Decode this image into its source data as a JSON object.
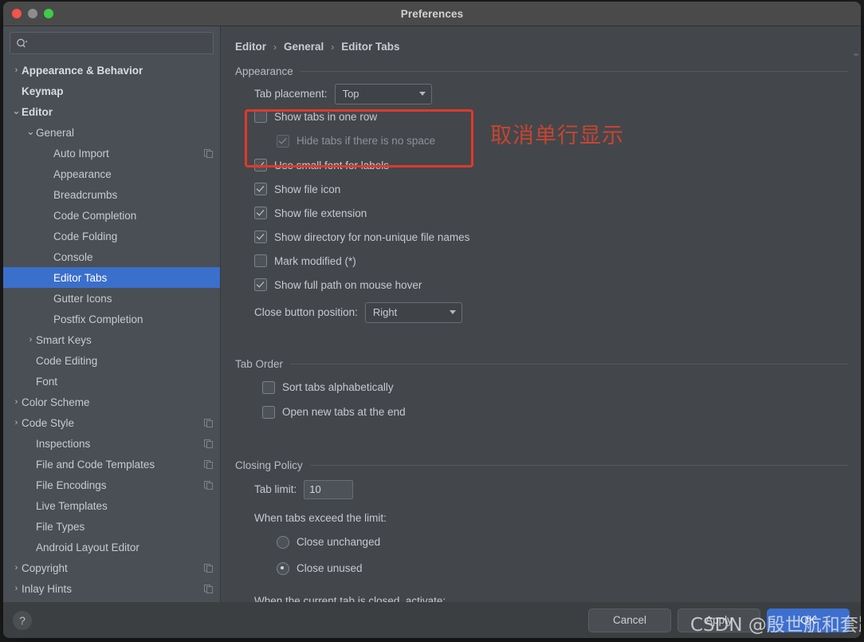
{
  "window": {
    "title": "Preferences",
    "traffic_lights": [
      "close-button",
      "minimize-button",
      "zoom-button"
    ]
  },
  "search": {
    "value": "",
    "placeholder": "",
    "icon": "search-icon"
  },
  "sidebar": {
    "items": [
      {
        "label": "Appearance & Behavior",
        "indent": 0,
        "arrow": "›",
        "bold": true,
        "selected": false,
        "copy": false
      },
      {
        "label": "Keymap",
        "indent": 0,
        "arrow": "",
        "bold": true,
        "selected": false,
        "copy": false
      },
      {
        "label": "Editor",
        "indent": 0,
        "arrow": "⌄",
        "bold": true,
        "selected": false,
        "copy": false
      },
      {
        "label": "General",
        "indent": 1,
        "arrow": "⌄",
        "bold": false,
        "selected": false,
        "copy": false
      },
      {
        "label": "Auto Import",
        "indent": 2,
        "arrow": "",
        "bold": false,
        "selected": false,
        "copy": true
      },
      {
        "label": "Appearance",
        "indent": 2,
        "arrow": "",
        "bold": false,
        "selected": false,
        "copy": false
      },
      {
        "label": "Breadcrumbs",
        "indent": 2,
        "arrow": "",
        "bold": false,
        "selected": false,
        "copy": false
      },
      {
        "label": "Code Completion",
        "indent": 2,
        "arrow": "",
        "bold": false,
        "selected": false,
        "copy": false
      },
      {
        "label": "Code Folding",
        "indent": 2,
        "arrow": "",
        "bold": false,
        "selected": false,
        "copy": false
      },
      {
        "label": "Console",
        "indent": 2,
        "arrow": "",
        "bold": false,
        "selected": false,
        "copy": false
      },
      {
        "label": "Editor Tabs",
        "indent": 2,
        "arrow": "",
        "bold": false,
        "selected": true,
        "copy": false
      },
      {
        "label": "Gutter Icons",
        "indent": 2,
        "arrow": "",
        "bold": false,
        "selected": false,
        "copy": false
      },
      {
        "label": "Postfix Completion",
        "indent": 2,
        "arrow": "",
        "bold": false,
        "selected": false,
        "copy": false
      },
      {
        "label": "Smart Keys",
        "indent": 1,
        "arrow": "›",
        "bold": false,
        "selected": false,
        "copy": false
      },
      {
        "label": "Code Editing",
        "indent": 1,
        "arrow": "",
        "bold": false,
        "selected": false,
        "copy": false
      },
      {
        "label": "Font",
        "indent": 1,
        "arrow": "",
        "bold": false,
        "selected": false,
        "copy": false
      },
      {
        "label": "Color Scheme",
        "indent": 0,
        "arrow": "›",
        "bold": false,
        "selected": false,
        "copy": false
      },
      {
        "label": "Code Style",
        "indent": 0,
        "arrow": "›",
        "bold": false,
        "selected": false,
        "copy": true
      },
      {
        "label": "Inspections",
        "indent": 1,
        "arrow": "",
        "bold": false,
        "selected": false,
        "copy": true
      },
      {
        "label": "File and Code Templates",
        "indent": 1,
        "arrow": "",
        "bold": false,
        "selected": false,
        "copy": true
      },
      {
        "label": "File Encodings",
        "indent": 1,
        "arrow": "",
        "bold": false,
        "selected": false,
        "copy": true
      },
      {
        "label": "Live Templates",
        "indent": 1,
        "arrow": "",
        "bold": false,
        "selected": false,
        "copy": false
      },
      {
        "label": "File Types",
        "indent": 1,
        "arrow": "",
        "bold": false,
        "selected": false,
        "copy": false
      },
      {
        "label": "Android Layout Editor",
        "indent": 1,
        "arrow": "",
        "bold": false,
        "selected": false,
        "copy": false
      },
      {
        "label": "Copyright",
        "indent": 0,
        "arrow": "›",
        "bold": false,
        "selected": false,
        "copy": true
      },
      {
        "label": "Inlay Hints",
        "indent": 0,
        "arrow": "›",
        "bold": false,
        "selected": false,
        "copy": true
      }
    ]
  },
  "breadcrumb": {
    "items": [
      "Editor",
      "General",
      "Editor Tabs"
    ],
    "separator": "›"
  },
  "main": {
    "appearance": {
      "title": "Appearance",
      "tab_placement_label": "Tab placement:",
      "tab_placement_value": "Top",
      "checkboxes": [
        {
          "label": "Show tabs in one row",
          "checked": false,
          "disabled": false,
          "indent": 24
        },
        {
          "label": "Hide tabs if there is no space",
          "checked": true,
          "disabled": true,
          "indent": 52
        },
        {
          "label": "Use small font for labels",
          "checked": true,
          "disabled": false,
          "indent": 24
        },
        {
          "label": "Show file icon",
          "checked": true,
          "disabled": false,
          "indent": 24
        },
        {
          "label": "Show file extension",
          "checked": true,
          "disabled": false,
          "indent": 24
        },
        {
          "label": "Show directory for non-unique file names",
          "checked": true,
          "disabled": false,
          "indent": 24
        },
        {
          "label": "Mark modified (*)",
          "checked": false,
          "disabled": false,
          "indent": 24
        },
        {
          "label": "Show full path on mouse hover",
          "checked": true,
          "disabled": false,
          "indent": 24
        }
      ],
      "close_button_label": "Close button position:",
      "close_button_value": "Right"
    },
    "tab_order": {
      "title": "Tab Order",
      "checkboxes": [
        {
          "label": "Sort tabs alphabetically",
          "checked": false
        },
        {
          "label": "Open new tabs at the end",
          "checked": false
        }
      ]
    },
    "closing_policy": {
      "title": "Closing Policy",
      "tab_limit_label": "Tab limit:",
      "tab_limit_value": "10",
      "exceed_label": "When tabs exceed the limit:",
      "radios": [
        {
          "label": "Close unchanged",
          "selected": false
        },
        {
          "label": "Close unused",
          "selected": true
        }
      ],
      "activate_label": "When the current tab is closed, activate:"
    }
  },
  "annotation": {
    "text": "取消单行显示",
    "box_color": "#e03a2a",
    "text_color": "#c8442f"
  },
  "footer": {
    "help_label": "?",
    "cancel_label": "Cancel",
    "apply_label": "Apply",
    "ok_label": "OK"
  },
  "watermark": {
    "text": "CSDN @殷世航和套路璐"
  },
  "colors": {
    "selection_blue": "#3b6fcc",
    "primary_button": "#3c6fcf",
    "sidebar_bg": "#4a4e55",
    "main_bg": "#43474c",
    "titlebar_bg": "#4a4a4a"
  }
}
